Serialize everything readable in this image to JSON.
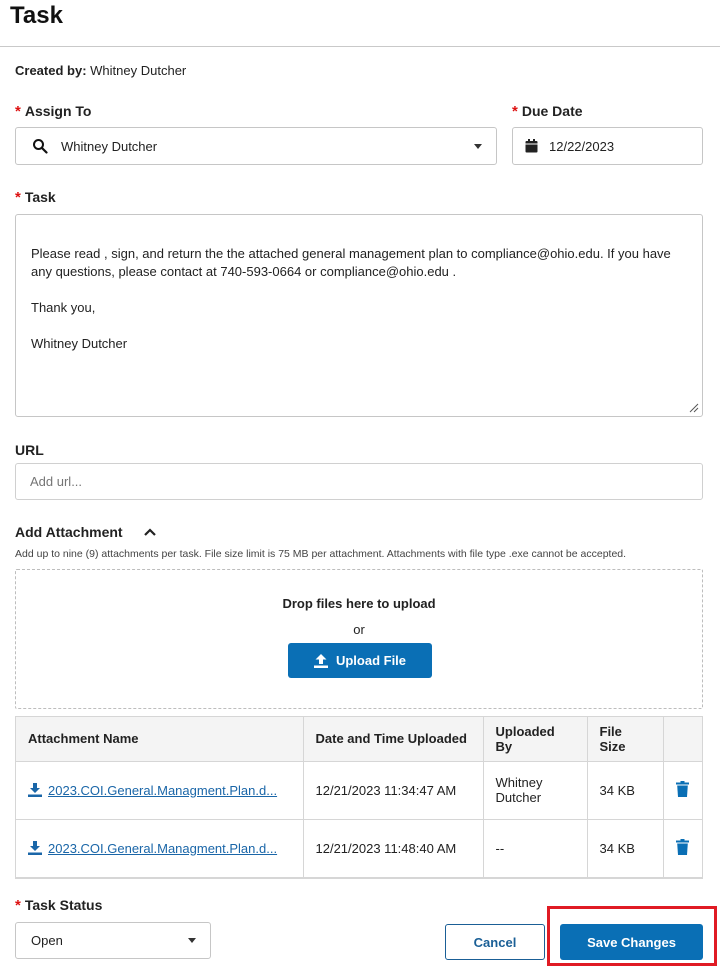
{
  "page": {
    "title": "Task"
  },
  "created_by": {
    "label": "Created by:",
    "value": "Whitney Dutcher"
  },
  "assign_to": {
    "label": "Assign To",
    "value": "Whitney Dutcher"
  },
  "due_date": {
    "label": "Due Date",
    "value": "12/22/2023"
  },
  "task": {
    "label": "Task",
    "lines": [
      "Please read , sign, and return the the attached general management plan to compliance@ohio.edu. If you have any questions, please contact at 740-593-0664 or compliance@ohio.edu .",
      "Thank you,",
      "Whitney Dutcher"
    ]
  },
  "url": {
    "label": "URL",
    "placeholder": "Add url..."
  },
  "attachments": {
    "label": "Add Attachment",
    "hint": "Add up to nine (9) attachments per task. File size limit is 75 MB per attachment. Attachments with file type .exe cannot be accepted.",
    "drop_text": "Drop files here to upload",
    "or_text": "or",
    "upload_label": "Upload File",
    "columns": [
      "Attachment Name",
      "Date and Time Uploaded",
      "Uploaded By",
      "File Size"
    ],
    "rows": [
      {
        "name": "2023.COI.General.Managment.Plan.d...",
        "uploaded": "12/21/2023 11:34:47 AM",
        "by": "Whitney Dutcher",
        "size": "34 KB"
      },
      {
        "name": "2023.COI.General.Managment.Plan.d...",
        "uploaded": "12/21/2023 11:48:40 AM",
        "by": "--",
        "size": "34 KB"
      }
    ]
  },
  "task_status": {
    "label": "Task Status",
    "value": "Open"
  },
  "actions": {
    "cancel_label": "Cancel",
    "save_label": "Save Changes"
  },
  "colors": {
    "primary": "#0a6fb5",
    "required": "#dd1111",
    "highlight": "#e01b24"
  }
}
